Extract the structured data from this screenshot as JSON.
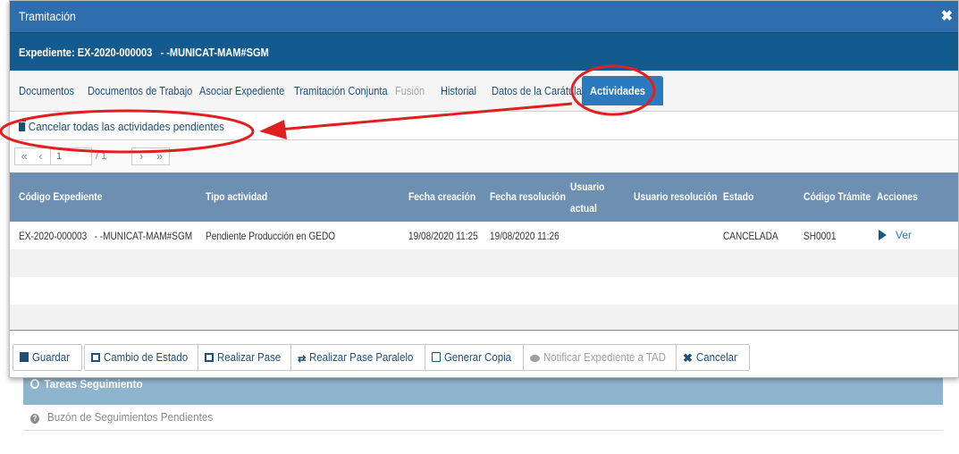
{
  "background": {
    "panel_title": "Tareas Seguimiento",
    "link_label": "Buzón de Seguimientos Pendientes"
  },
  "modal": {
    "title": "Tramitación",
    "close_icon": "close-icon",
    "expediente": "Expediente: EX-2020-000003   - -MUNICAT-MAM#SGM",
    "tabs": [
      {
        "label": "Documentos",
        "state": "normal"
      },
      {
        "label": "Documentos de Trabajo",
        "state": "normal"
      },
      {
        "label": "Asociar Expediente",
        "state": "normal"
      },
      {
        "label": "Tramitación Conjunta",
        "state": "normal"
      },
      {
        "label": "Fusión",
        "state": "disabled"
      },
      {
        "label": "Historial",
        "state": "normal"
      },
      {
        "label": "Datos de la Carátula",
        "state": "normal"
      },
      {
        "label": "Actividades",
        "state": "active"
      }
    ],
    "cancel_all_label": "Cancelar todas las actividades pendientes",
    "pager": {
      "first": "«",
      "prev": "‹",
      "page": "1",
      "total": "/ 1",
      "next": "›",
      "last": "»"
    },
    "grid": {
      "columns": [
        "Código Expediente",
        "Tipo actividad",
        "Fecha creación",
        "Fecha resolución",
        "Usuario",
        "actual",
        "Usuario resolución",
        "Estado",
        "Código Trámite",
        "Acciones"
      ],
      "rows": [
        {
          "codigo": "EX-2020-000003   - -MUNICAT-MAM#SGM",
          "tipo": "Pendiente Producción en GEDO",
          "creacion": "19/08/2020 11:25",
          "resolucion": "19/08/2020 11:26",
          "usuario_actual": "",
          "usuario_resolucion": "",
          "estado": "CANCELADA",
          "tramite": "SH0001",
          "accion": "Ver"
        }
      ]
    },
    "buttons": {
      "guardar": "Guardar",
      "cambio_estado": "Cambio de Estado",
      "realizar_pase": "Realizar Pase",
      "pase_paralelo": "Realizar Pase Paralelo",
      "generar_copia": "Generar Copia",
      "notificar": "Notificar Expediente a TAD",
      "cancelar": "Cancelar"
    }
  },
  "colors": {
    "titlebar": "#2f6eac",
    "expediente_bar": "#135b8e",
    "grid_header": "#6c8fb2",
    "active_tab": "#2a7abf",
    "annotation": "#e02020"
  }
}
